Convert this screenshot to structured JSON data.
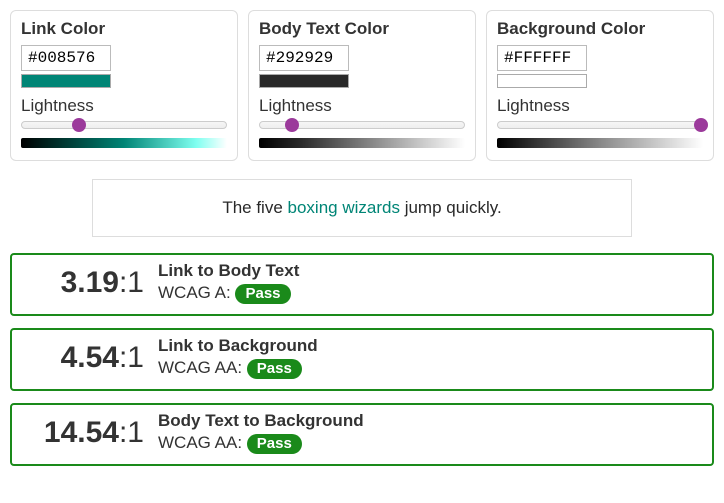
{
  "pickers": {
    "link": {
      "title": "Link Color",
      "hex": "#008576",
      "swatch": "#008576",
      "lightness_label": "Lightness",
      "slider_pct": 28,
      "gradient": "linear-gradient(to right,#000,#008576 50%,#7ffff0 85%,#fff)"
    },
    "body": {
      "title": "Body Text Color",
      "hex": "#292929",
      "swatch": "#292929",
      "lightness_label": "Lightness",
      "slider_pct": 16,
      "gradient": "linear-gradient(to right,#000,#292929 20%,#ccc 80%,#fff)"
    },
    "bg": {
      "title": "Background Color",
      "hex": "#FFFFFF",
      "swatch": "#FFFFFF",
      "lightness_label": "Lightness",
      "slider_pct": 99,
      "gradient": "linear-gradient(to right,#000,#888 50%,#fff)"
    }
  },
  "preview": {
    "before": "The five ",
    "link": "boxing wizards",
    "after": " jump quickly."
  },
  "results": [
    {
      "ratio_num": "3.19",
      "ratio_suffix": ":1",
      "comparison": "Link to Body Text",
      "level_prefix": "WCAG A: ",
      "status": "Pass"
    },
    {
      "ratio_num": "4.54",
      "ratio_suffix": ":1",
      "comparison": "Link to Background",
      "level_prefix": "WCAG AA: ",
      "status": "Pass"
    },
    {
      "ratio_num": "14.54",
      "ratio_suffix": ":1",
      "comparison": "Body Text to Background",
      "level_prefix": "WCAG AA: ",
      "status": "Pass"
    }
  ]
}
